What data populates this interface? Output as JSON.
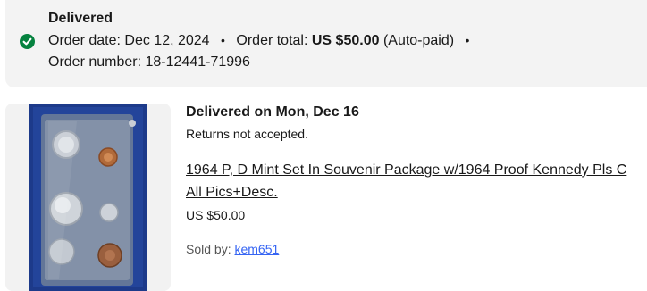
{
  "status": {
    "title": "Delivered",
    "order_date_label": "Order date:",
    "order_date": "Dec 12, 2024",
    "order_total_label": "Order total:",
    "order_total": "US $50.00",
    "payment_note": "(Auto-paid)",
    "order_number_label": "Order number:",
    "order_number": "18-12441-71996",
    "icon": "check-circle-icon",
    "icon_color": "#05823f"
  },
  "item": {
    "delivery_heading": "Delivered on Mon, Dec 16",
    "returns_note": "Returns not accepted.",
    "title_line1": "1964 P, D Mint Set In Souvenir Package w/1964 Proof Kennedy Pls C",
    "title_line2": "All Pics+Desc.",
    "price": "US $50.00",
    "sold_by_label": "Sold by:",
    "seller": "kem651",
    "link_color": "#3665f3"
  }
}
